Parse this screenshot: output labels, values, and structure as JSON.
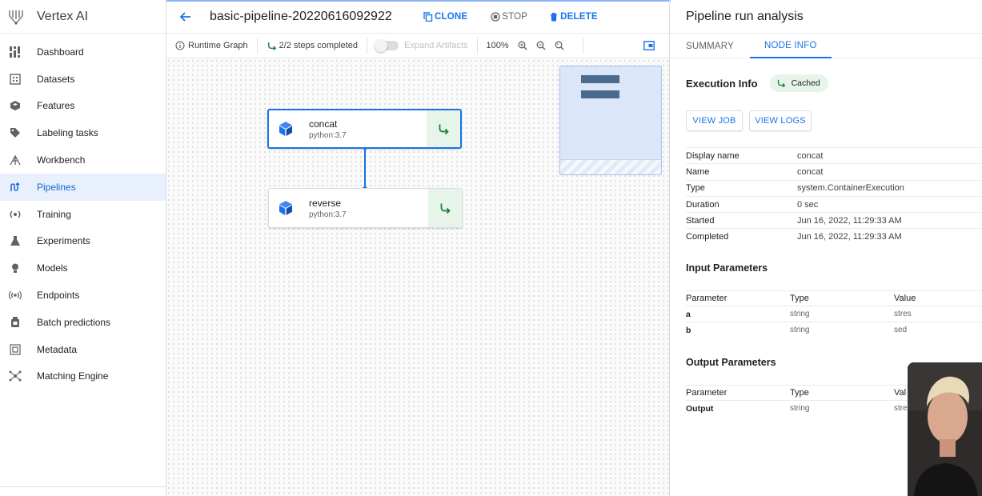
{
  "app": {
    "name": "Vertex AI"
  },
  "sidebar": {
    "items": [
      {
        "label": "Dashboard",
        "icon": "dashboard-icon"
      },
      {
        "label": "Datasets",
        "icon": "datasets-icon"
      },
      {
        "label": "Features",
        "icon": "features-icon"
      },
      {
        "label": "Labeling tasks",
        "icon": "label-tag-icon"
      },
      {
        "label": "Workbench",
        "icon": "workbench-icon"
      },
      {
        "label": "Pipelines",
        "icon": "pipelines-icon",
        "active": true
      },
      {
        "label": "Training",
        "icon": "training-icon"
      },
      {
        "label": "Experiments",
        "icon": "flask-icon"
      },
      {
        "label": "Models",
        "icon": "lightbulb-icon"
      },
      {
        "label": "Endpoints",
        "icon": "broadcast-icon"
      },
      {
        "label": "Batch predictions",
        "icon": "batch-icon"
      },
      {
        "label": "Metadata",
        "icon": "metadata-icon"
      },
      {
        "label": "Matching Engine",
        "icon": "network-icon"
      }
    ]
  },
  "header": {
    "run_name": "basic-pipeline-20220616092922",
    "clone_label": "CLONE",
    "stop_label": "STOP",
    "delete_label": "DELETE"
  },
  "toolbar": {
    "runtime_graph": "Runtime Graph",
    "steps_completed": "2/2 steps completed",
    "expand_artifacts": "Expand Artifacts",
    "zoom_level": "100%"
  },
  "graph": {
    "nodes": [
      {
        "name": "concat",
        "image": "python:3.7",
        "status": "cached",
        "selected": true
      },
      {
        "name": "reverse",
        "image": "python:3.7",
        "status": "cached",
        "selected": false
      }
    ]
  },
  "panel": {
    "title": "Pipeline run analysis",
    "tabs": [
      "SUMMARY",
      "NODE INFO"
    ],
    "active_tab": "NODE INFO",
    "execution_info_label": "Execution Info",
    "status_chip": "Cached",
    "view_job_label": "VIEW JOB",
    "view_logs_label": "VIEW LOGS",
    "details": [
      {
        "key": "Display name",
        "value": "concat"
      },
      {
        "key": "Name",
        "value": "concat"
      },
      {
        "key": "Type",
        "value": "system.ContainerExecution"
      },
      {
        "key": "Duration",
        "value": "0 sec"
      },
      {
        "key": "Started",
        "value": "Jun 16, 2022, 11:29:33 AM"
      },
      {
        "key": "Completed",
        "value": "Jun 16, 2022, 11:29:33 AM"
      }
    ],
    "input_parameters": {
      "title": "Input Parameters",
      "headers": [
        "Parameter",
        "Type",
        "Value"
      ],
      "rows": [
        {
          "param": "a",
          "type": "string",
          "value": "stres"
        },
        {
          "param": "b",
          "type": "string",
          "value": "sed"
        }
      ]
    },
    "output_parameters": {
      "title": "Output Parameters",
      "headers": [
        "Parameter",
        "Type",
        "Val"
      ],
      "rows": [
        {
          "param": "Output",
          "type": "string",
          "value": "stre"
        }
      ]
    }
  },
  "colors": {
    "accent": "#1a73e8",
    "cached_green": "#188038",
    "cached_bg": "#e6f4ea",
    "active_nav_bg": "#e8f0fe"
  }
}
